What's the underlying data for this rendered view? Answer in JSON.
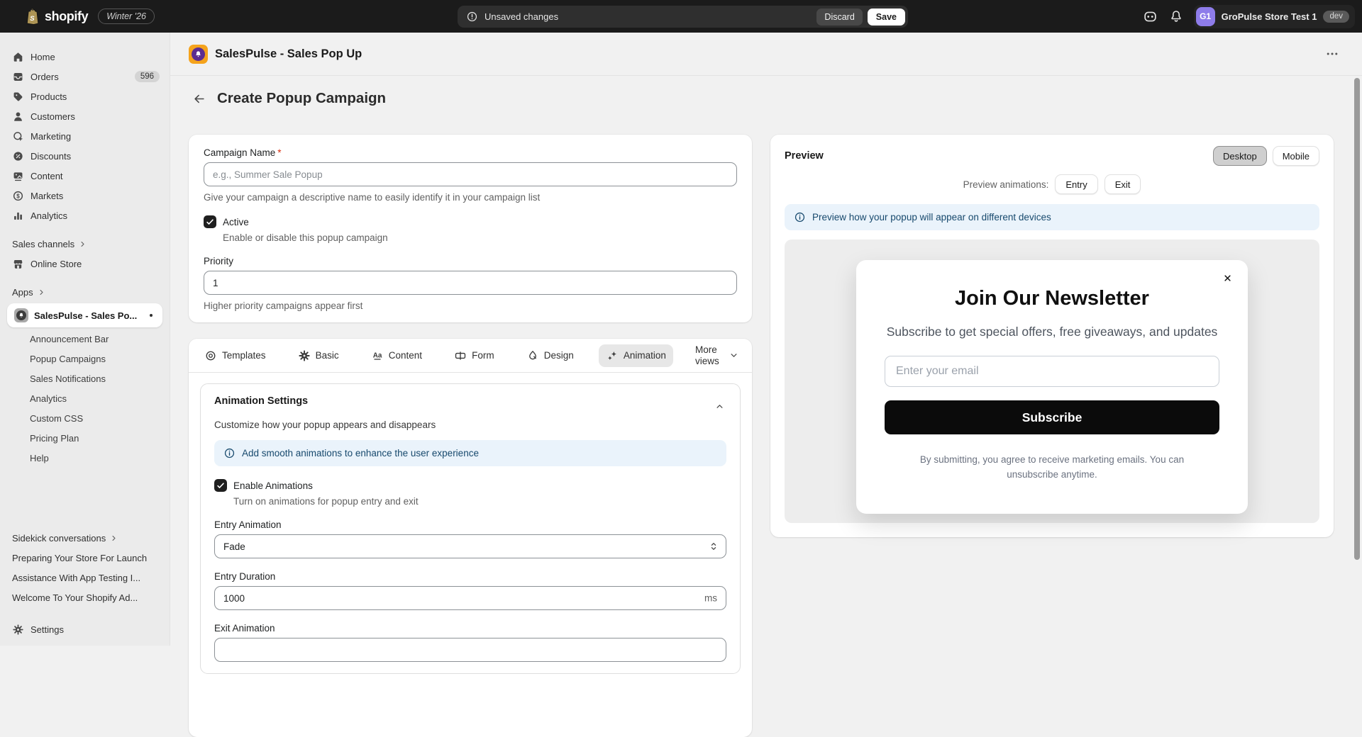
{
  "topbar": {
    "brand": "shopify",
    "release_badge": "Winter '26",
    "unsaved_status": "Unsaved changes",
    "discard_label": "Discard",
    "save_label": "Save",
    "account_initials": "G1",
    "account_name": "GroPulse Store Test 1",
    "env_badge": "dev"
  },
  "sidebar": {
    "items": [
      {
        "label": "Home"
      },
      {
        "label": "Orders",
        "badge": "596"
      },
      {
        "label": "Products"
      },
      {
        "label": "Customers"
      },
      {
        "label": "Marketing"
      },
      {
        "label": "Discounts"
      },
      {
        "label": "Content"
      },
      {
        "label": "Markets"
      },
      {
        "label": "Analytics"
      }
    ],
    "sales_channels_label": "Sales channels",
    "online_store_label": "Online Store",
    "apps_label": "Apps",
    "app_name": "SalesPulse - Sales Po...",
    "app_subitems": [
      {
        "label": "Announcement Bar"
      },
      {
        "label": "Popup Campaigns"
      },
      {
        "label": "Sales Notifications"
      },
      {
        "label": "Analytics"
      },
      {
        "label": "Custom CSS"
      },
      {
        "label": "Pricing Plan"
      },
      {
        "label": "Help"
      }
    ],
    "sidekick_label": "Sidekick conversations",
    "conversations": [
      {
        "label": "Preparing Your Store For Launch"
      },
      {
        "label": "Assistance With App Testing I..."
      },
      {
        "label": "Welcome To Your Shopify Ad..."
      }
    ],
    "settings_label": "Settings"
  },
  "app_header": {
    "title": "SalesPulse - Sales Pop Up"
  },
  "page": {
    "title": "Create Popup Campaign"
  },
  "campaign_card": {
    "name_label": "Campaign Name",
    "required_mark": "*",
    "name_placeholder": "e.g., Summer Sale Popup",
    "name_help": "Give your campaign a descriptive name to easily identify it in your campaign list",
    "active_label": "Active",
    "active_help": "Enable or disable this popup campaign",
    "priority_label": "Priority",
    "priority_value": "1",
    "priority_help": "Higher priority campaigns appear first"
  },
  "tabs": [
    {
      "label": "Templates"
    },
    {
      "label": "Basic"
    },
    {
      "label": "Content"
    },
    {
      "label": "Form"
    },
    {
      "label": "Design"
    },
    {
      "label": "Animation"
    },
    {
      "label": "More views"
    }
  ],
  "animation_card": {
    "title": "Animation Settings",
    "subtitle": "Customize how your popup appears and disappears",
    "banner_text": "Add smooth animations to enhance the user experience",
    "enable_label": "Enable Animations",
    "enable_help": "Turn on animations for popup entry and exit",
    "entry_animation_label": "Entry Animation",
    "entry_animation_value": "Fade",
    "entry_duration_label": "Entry Duration",
    "entry_duration_value": "1000",
    "entry_duration_suffix": "ms",
    "exit_animation_label": "Exit Animation"
  },
  "preview_card": {
    "title": "Preview",
    "desktop_label": "Desktop",
    "mobile_label": "Mobile",
    "animations_label": "Preview animations:",
    "entry_button": "Entry",
    "exit_button": "Exit",
    "banner_text": "Preview how your popup will appear on different devices",
    "popup": {
      "title": "Join Our Newsletter",
      "subtitle": "Subscribe to get special offers, free giveaways, and updates",
      "email_placeholder": "Enter your email",
      "subscribe_label": "Subscribe",
      "disclaimer": "By submitting, you agree to receive marketing emails. You can unsubscribe anytime."
    }
  },
  "colors": {
    "topbar_bg": "#1b1b1b",
    "sidebar_bg": "#ebebeb",
    "page_bg": "#f1f1f1",
    "avatar_purple": "#8e7cea",
    "info_banner_bg": "#eaf3fb",
    "info_banner_text": "#17496d",
    "app_icon_orange": "#f5a31c",
    "app_icon_purple": "#5c2d91",
    "subscribe_black": "#0b0b0b",
    "save_white": "#ffffff"
  }
}
